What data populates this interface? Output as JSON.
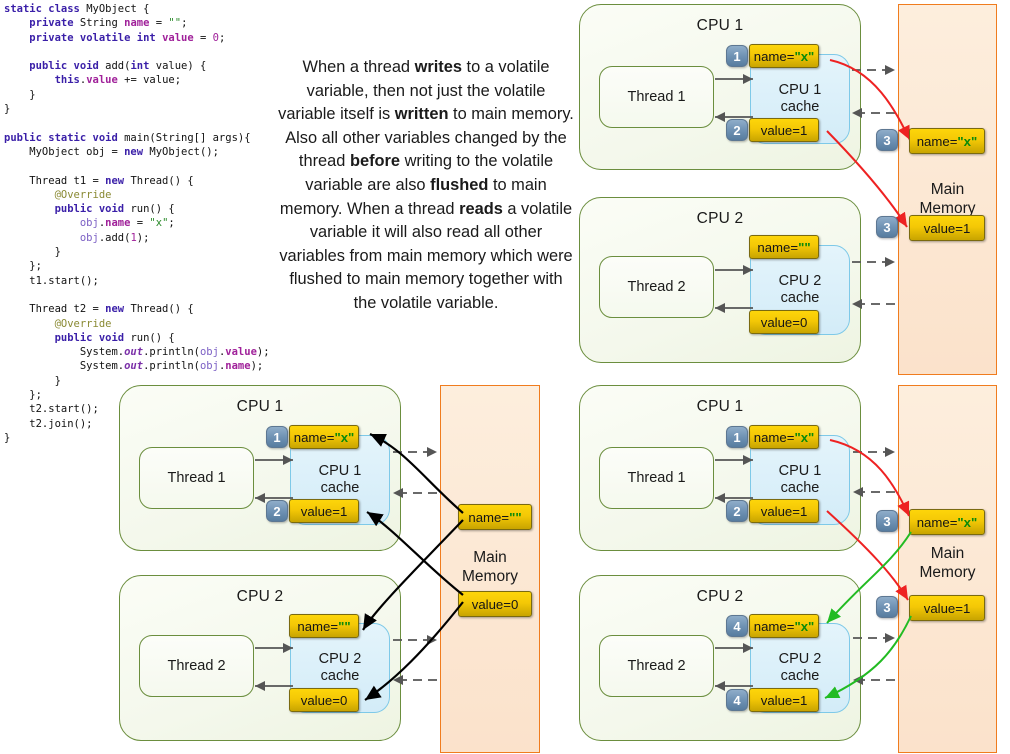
{
  "code": {
    "title": "MyObject volatile example",
    "lines": [
      [
        {
          "t": "static ",
          "c": "k"
        },
        {
          "t": "class ",
          "c": "k"
        },
        {
          "t": "MyObject {",
          "c": "pl"
        }
      ],
      [
        {
          "t": "    ",
          "c": "pl"
        },
        {
          "t": "private ",
          "c": "k"
        },
        {
          "t": "String ",
          "c": "pl"
        },
        {
          "t": "name",
          "c": "fld"
        },
        {
          "t": " = ",
          "c": "pl"
        },
        {
          "t": "\"\"",
          "c": "str"
        },
        {
          "t": ";",
          "c": "pl"
        }
      ],
      [
        {
          "t": "    ",
          "c": "pl"
        },
        {
          "t": "private volatile ",
          "c": "k"
        },
        {
          "t": "int ",
          "c": "k"
        },
        {
          "t": "value",
          "c": "fld"
        },
        {
          "t": " = ",
          "c": "pl"
        },
        {
          "t": "0",
          "c": "num"
        },
        {
          "t": ";",
          "c": "pl"
        }
      ],
      [
        {
          "t": "",
          "c": "pl"
        }
      ],
      [
        {
          "t": "    ",
          "c": "pl"
        },
        {
          "t": "public void ",
          "c": "k"
        },
        {
          "t": "add(",
          "c": "pl"
        },
        {
          "t": "int ",
          "c": "k"
        },
        {
          "t": "value) {",
          "c": "pl"
        }
      ],
      [
        {
          "t": "        ",
          "c": "pl"
        },
        {
          "t": "this",
          "c": "k"
        },
        {
          "t": ".",
          "c": "pl"
        },
        {
          "t": "value",
          "c": "fld"
        },
        {
          "t": " += value;",
          "c": "pl"
        }
      ],
      [
        {
          "t": "    }",
          "c": "pl"
        }
      ],
      [
        {
          "t": "}",
          "c": "pl"
        }
      ],
      [
        {
          "t": "",
          "c": "pl"
        }
      ],
      [
        {
          "t": "public static void ",
          "c": "k"
        },
        {
          "t": "main(String[] args){",
          "c": "pl"
        }
      ],
      [
        {
          "t": "    MyObject obj = ",
          "c": "pl"
        },
        {
          "t": "new ",
          "c": "k"
        },
        {
          "t": "MyObject();",
          "c": "pl"
        }
      ],
      [
        {
          "t": "",
          "c": "pl"
        }
      ],
      [
        {
          "t": "    Thread t1 = ",
          "c": "pl"
        },
        {
          "t": "new ",
          "c": "k"
        },
        {
          "t": "Thread() {",
          "c": "pl"
        }
      ],
      [
        {
          "t": "        ",
          "c": "pl"
        },
        {
          "t": "@Override",
          "c": "ann"
        }
      ],
      [
        {
          "t": "        ",
          "c": "pl"
        },
        {
          "t": "public void ",
          "c": "k"
        },
        {
          "t": "run() {",
          "c": "pl"
        }
      ],
      [
        {
          "t": "            ",
          "c": "pl"
        },
        {
          "t": "obj",
          "c": "var"
        },
        {
          "t": ".",
          "c": "pl"
        },
        {
          "t": "name",
          "c": "fld"
        },
        {
          "t": " = ",
          "c": "pl"
        },
        {
          "t": "\"x\"",
          "c": "str"
        },
        {
          "t": ";",
          "c": "pl"
        }
      ],
      [
        {
          "t": "            ",
          "c": "pl"
        },
        {
          "t": "obj",
          "c": "var"
        },
        {
          "t": ".add(",
          "c": "pl"
        },
        {
          "t": "1",
          "c": "num"
        },
        {
          "t": ");",
          "c": "pl"
        }
      ],
      [
        {
          "t": "        }",
          "c": "pl"
        }
      ],
      [
        {
          "t": "    };",
          "c": "pl"
        }
      ],
      [
        {
          "t": "    t1.start();",
          "c": "pl"
        }
      ],
      [
        {
          "t": "",
          "c": "pl"
        }
      ],
      [
        {
          "t": "    Thread t2 = ",
          "c": "pl"
        },
        {
          "t": "new ",
          "c": "k"
        },
        {
          "t": "Thread() {",
          "c": "pl"
        }
      ],
      [
        {
          "t": "        ",
          "c": "pl"
        },
        {
          "t": "@Override",
          "c": "ann"
        }
      ],
      [
        {
          "t": "        ",
          "c": "pl"
        },
        {
          "t": "public void ",
          "c": "k"
        },
        {
          "t": "run() {",
          "c": "pl"
        }
      ],
      [
        {
          "t": "            System.",
          "c": "pl"
        },
        {
          "t": "out",
          "c": "ital"
        },
        {
          "t": ".println(",
          "c": "pl"
        },
        {
          "t": "obj",
          "c": "var"
        },
        {
          "t": ".",
          "c": "pl"
        },
        {
          "t": "value",
          "c": "fld"
        },
        {
          "t": ");",
          "c": "pl"
        }
      ],
      [
        {
          "t": "            System.",
          "c": "pl"
        },
        {
          "t": "out",
          "c": "ital"
        },
        {
          "t": ".println(",
          "c": "pl"
        },
        {
          "t": "obj",
          "c": "var"
        },
        {
          "t": ".",
          "c": "pl"
        },
        {
          "t": "name",
          "c": "fld"
        },
        {
          "t": ");",
          "c": "pl"
        }
      ],
      [
        {
          "t": "        }",
          "c": "pl"
        }
      ],
      [
        {
          "t": "    };",
          "c": "pl"
        }
      ],
      [
        {
          "t": "    t2.start();",
          "c": "pl"
        }
      ],
      [
        {
          "t": "    t2.join();",
          "c": "pl"
        }
      ],
      [
        {
          "t": "}",
          "c": "pl"
        }
      ]
    ]
  },
  "explanation": {
    "segments": [
      {
        "t": "When a thread ",
        "b": false
      },
      {
        "t": "writes",
        "b": true
      },
      {
        "t": " to a volatile variable, then not just the volatile variable itself is ",
        "b": false
      },
      {
        "t": "written",
        "b": true
      },
      {
        "t": " to main memory. Also all other variables changed by the thread ",
        "b": false
      },
      {
        "t": "before",
        "b": true
      },
      {
        "t": " writing to the volatile variable are also ",
        "b": false
      },
      {
        "t": "flushed",
        "b": true
      },
      {
        "t": " to main memory. When a thread ",
        "b": false
      },
      {
        "t": "reads",
        "b": true
      },
      {
        "t": " a volatile variable it will also read all other variables from main memory which were flushed to main memory together with the volatile variable.",
        "b": false
      }
    ]
  },
  "colors": {
    "cpu_border": "#6b8e3e",
    "cpu_fill": "#f4f8ec",
    "cache_border": "#7ec9e8",
    "cache_fill": "#d9eff9",
    "memory_border": "#f07c1e",
    "memory_fill": "#fbe2cb",
    "chip_yellow": "#f4c806",
    "chip_value_green": "#0a8a0a",
    "badge_blue": "#6f92b4",
    "arrow_red": "#ee2222",
    "arrow_green": "#22bb22",
    "arrow_black": "#000000",
    "arrow_gray": "#555555"
  },
  "panels": [
    {
      "id": "top-right",
      "name": "volatile-write-flush",
      "cpus": [
        {
          "title": "CPU 1",
          "thread": "Thread 1",
          "cache": "CPU 1\ncache",
          "cache_line1": "CPU 1",
          "cache_line2": "cache",
          "chips": [
            {
              "prefix": "name=",
              "value": "\"x\"",
              "badge": "1"
            },
            {
              "prefix": "value=1",
              "value": "",
              "badge": "2"
            }
          ]
        },
        {
          "title": "CPU 2",
          "thread": "Thread 2",
          "cache_line1": "CPU 2",
          "cache_line2": "cache",
          "chips": [
            {
              "prefix": "name=",
              "value": "\"\"",
              "badge": ""
            },
            {
              "prefix": "value=0",
              "value": "",
              "badge": ""
            }
          ]
        }
      ],
      "memory": {
        "label_line1": "Main",
        "label_line2": "Memory",
        "chips": [
          {
            "prefix": "name=",
            "value": "\"x\"",
            "badge": "3"
          },
          {
            "prefix": "value=1",
            "value": "",
            "badge": "3"
          }
        ]
      }
    },
    {
      "id": "bottom-left",
      "name": "non-volatile-stale-read",
      "cpus": [
        {
          "title": "CPU 1",
          "thread": "Thread 1",
          "cache_line1": "CPU 1",
          "cache_line2": "cache",
          "chips": [
            {
              "prefix": "name=",
              "value": "\"x\"",
              "badge": "1"
            },
            {
              "prefix": "value=1",
              "value": "",
              "badge": "2"
            }
          ]
        },
        {
          "title": "CPU 2",
          "thread": "Thread 2",
          "cache_line1": "CPU 2",
          "cache_line2": "cache",
          "chips": [
            {
              "prefix": "name=",
              "value": "\"\"",
              "badge": ""
            },
            {
              "prefix": "value=0",
              "value": "",
              "badge": ""
            }
          ]
        }
      ],
      "memory": {
        "label_line1": "Main",
        "label_line2": "Memory",
        "chips": [
          {
            "prefix": "name=",
            "value": "\"\"",
            "badge": ""
          },
          {
            "prefix": "value=0",
            "value": "",
            "badge": ""
          }
        ]
      }
    },
    {
      "id": "bottom-right",
      "name": "volatile-read-refresh",
      "cpus": [
        {
          "title": "CPU 1",
          "thread": "Thread 1",
          "cache_line1": "CPU 1",
          "cache_line2": "cache",
          "chips": [
            {
              "prefix": "name=",
              "value": "\"x\"",
              "badge": "1"
            },
            {
              "prefix": "value=1",
              "value": "",
              "badge": "2"
            }
          ]
        },
        {
          "title": "CPU 2",
          "thread": "Thread 2",
          "cache_line1": "CPU 2",
          "cache_line2": "cache",
          "chips": [
            {
              "prefix": "name=",
              "value": "\"x\"",
              "badge": "4"
            },
            {
              "prefix": "value=1",
              "value": "",
              "badge": "4"
            }
          ]
        }
      ],
      "memory": {
        "label_line1": "Main",
        "label_line2": "Memory",
        "chips": [
          {
            "prefix": "name=",
            "value": "\"x\"",
            "badge": "3"
          },
          {
            "prefix": "value=1",
            "value": "",
            "badge": "3"
          }
        ]
      }
    }
  ]
}
